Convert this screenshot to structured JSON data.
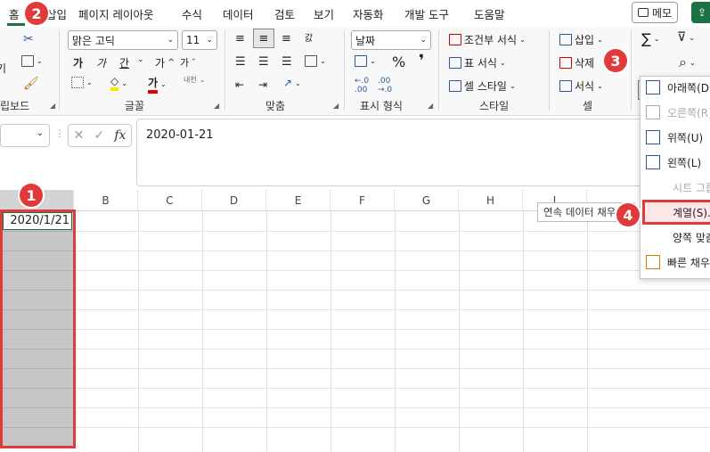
{
  "menubar": {
    "tabs": [
      "홈",
      "삽입",
      "페이지 레이아웃",
      "수식",
      "데이터",
      "검토",
      "보기",
      "자동화",
      "개발 도구",
      "도움말"
    ],
    "memo_label": "메모"
  },
  "ribbon": {
    "clipboard": {
      "paste_partial": "기",
      "label": "립보드"
    },
    "font": {
      "family": "맑은 고딕",
      "size": "11",
      "bold": "가",
      "italic": "가",
      "underline": "간",
      "grow": "가",
      "shrink": "가",
      "font_color_glyph": "가",
      "phonetic": "내천",
      "label": "글꼴"
    },
    "align": {
      "wrap_glyph": "갌",
      "label": "맞춤"
    },
    "number": {
      "format": "날짜",
      "percent": "%",
      "comma": "❜",
      "label": "표시 형식"
    },
    "styles": {
      "conditional": "조건부 서식",
      "table": "표 서식",
      "cell": "셀 스타일",
      "label": "스타일"
    },
    "cells": {
      "insert": "삽입",
      "delete": "삭제",
      "format": "서식",
      "label": "셀"
    },
    "editing": {
      "sum_glyph": "∑",
      "sort_glyph": "⊽",
      "find_glyph": "⌕"
    }
  },
  "formula_bar": {
    "fx": "fx",
    "value": "2020-01-21"
  },
  "grid": {
    "columns": [
      "B",
      "C",
      "D",
      "E",
      "F",
      "G",
      "H",
      "I"
    ],
    "cell_a1": "2020/1/21"
  },
  "fill_menu": {
    "items": [
      {
        "label": "아래쪽(D)",
        "enabled": true
      },
      {
        "label": "오른쪽(R)",
        "enabled": false
      },
      {
        "label": "위쪽(U)",
        "enabled": true
      },
      {
        "label": "왼쪽(L)",
        "enabled": true
      },
      {
        "label": "시트 그룹",
        "enabled": false
      },
      {
        "label": "계열(S)...",
        "enabled": true
      },
      {
        "label": "양쪽 맞춤",
        "enabled": true
      },
      {
        "label": "빠른 채우기",
        "enabled": true
      }
    ],
    "tooltip": "연속 데이터 채우기"
  },
  "badges": [
    "1",
    "2",
    "3",
    "4"
  ],
  "colors": {
    "accent": "#1a7343",
    "badge": "#e03a3a",
    "selection": "#c6c6c6"
  }
}
